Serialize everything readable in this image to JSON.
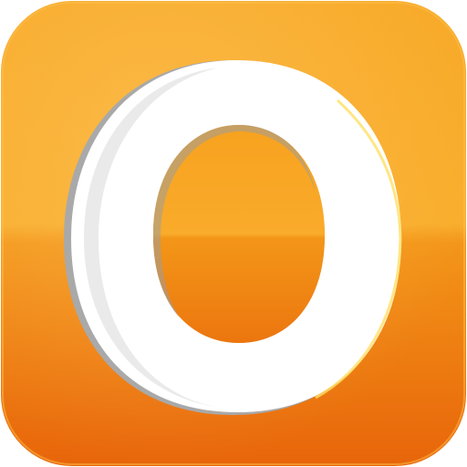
{
  "app_icon": {
    "icon": "letter-o-logo-icon",
    "logo_letter": "O",
    "colors": {
      "orange_light": "#f9ad2b",
      "orange_mid": "#f59a1c",
      "orange_dark": "#e9660a",
      "letter_white": "#ffffff",
      "letter_shadow": "#b8b8b8"
    }
  }
}
